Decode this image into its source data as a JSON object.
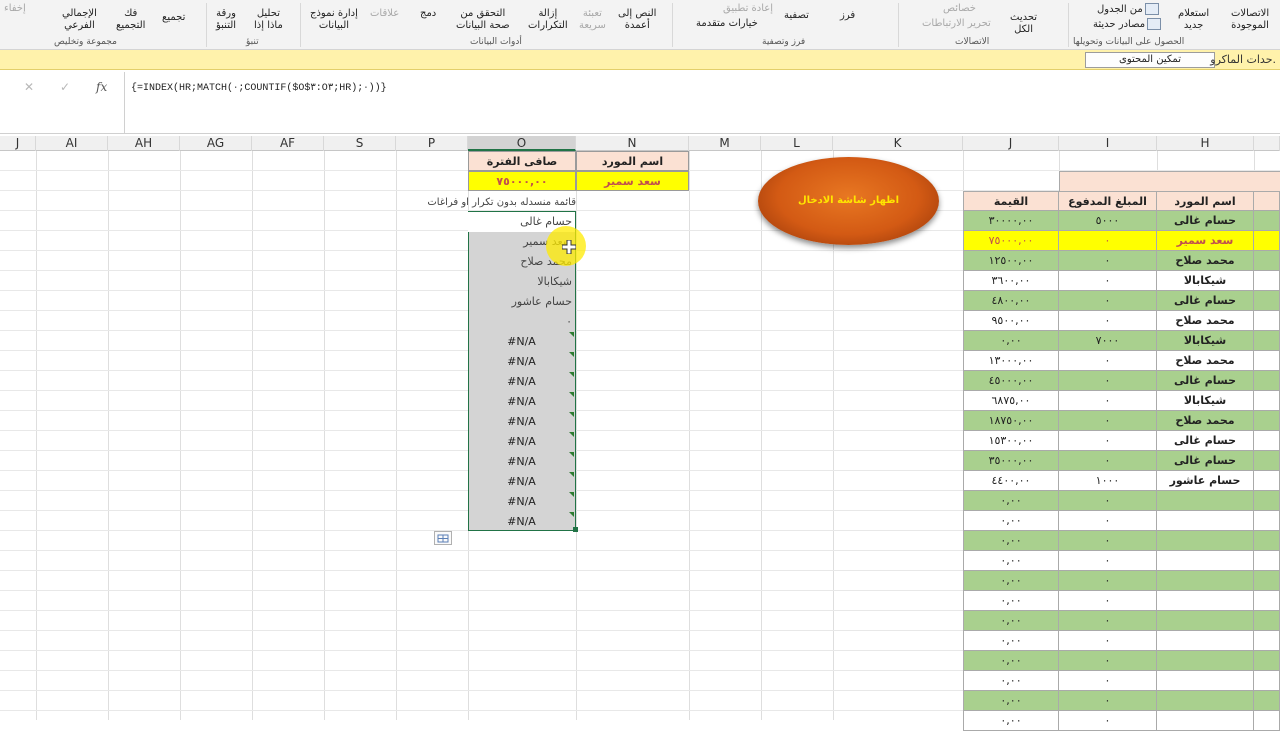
{
  "ribbon": {
    "buttons": {
      "existing_connections": "الاتصالات\nالموجودة",
      "new_query": "استعلام\nجديد",
      "from_table": "من الجدول",
      "recent_sources": "مصادر حديثة",
      "refresh_all": "تحديث\nالكل",
      "connections": "الاتصالات",
      "properties": "خصائص",
      "edit_links": "تحرير الارتباطات",
      "sort": "فرز",
      "filter": "تصفية",
      "clear": "مسح",
      "reapply": "إعادة تطبيق",
      "advanced": "خيارات متقدمة",
      "text_to_columns": "النص إلى\nأعمدة",
      "flash_fill": "تعبئة\nسريعة",
      "remove_duplicates": "إزالة\nالتكرارات",
      "data_validation": "التحقق من\nصحة البيانات",
      "consolidate": "دمج",
      "relationships": "علاقات",
      "manage_data_model": "إدارة نموذج\nالبيانات",
      "what_if": "تحليل\nماذا إذا",
      "forecast_sheet": "ورقة\nالتنبؤ",
      "group": "تجميع",
      "ungroup": "فك\nالتجميع",
      "subtotal": "الإجمالي\nالفرعي",
      "hide_detail": "إخفاء"
    },
    "groups": {
      "get_transform": "الحصول على البيانات وتحويلها",
      "connections": "الاتصالات",
      "sort_filter": "فرز وتصفية",
      "data_tools": "أدوات البيانات",
      "forecast": "تنبؤ",
      "outline": "مجموعة وتخليص"
    }
  },
  "message_bar": {
    "text": "حدات الماكرو.",
    "enable_button": "تمكين المحتوى"
  },
  "formula_bar": {
    "formula": "{=INDEX(HR;MATCH(٠;COUNTIF($O$٣:O٣;HR);٠))}",
    "icons": [
      "cancel-icon",
      "enter-icon",
      "fx-icon"
    ]
  },
  "columns": [
    "J",
    "AI",
    "AH",
    "AG",
    "AF",
    "S",
    "P",
    "O",
    "N",
    "M",
    "L",
    "K",
    "J",
    "I",
    "H"
  ],
  "summary": {
    "header_supplier": "اسم المورد",
    "header_net": "صافى الفترة",
    "supplier_value": "سعد سمير",
    "net_value": "٧٥٠٠٠,٠٠"
  },
  "list": {
    "title": "قائمة منسدله بدون تكرار او فراغات",
    "items": [
      "حسام غالى",
      "سعد سمير",
      "محمد صلاح",
      "شيكابالا",
      "حسام عاشور",
      "٠",
      "#N/A",
      "#N/A",
      "#N/A",
      "#N/A",
      "#N/A",
      "#N/A",
      "#N/A",
      "#N/A",
      "#N/A",
      "#N/A"
    ]
  },
  "button_oval": "اظهار شاشة الادخال",
  "table": {
    "headers": [
      "القيمة",
      "المبلغ المدفوع",
      "اسم المورد"
    ],
    "rows": [
      [
        "٣٠٠٠٠,٠٠",
        "٥٠٠٠",
        "حسام غالى"
      ],
      [
        "٧٥٠٠٠,٠٠",
        "٠",
        "سعد سمير"
      ],
      [
        "١٢٥٠٠,٠٠",
        "٠",
        "محمد صلاح"
      ],
      [
        "٣٦٠٠,٠٠",
        "٠",
        "شيكابالا"
      ],
      [
        "٤٨٠٠,٠٠",
        "٠",
        "حسام غالى"
      ],
      [
        "٩٥٠٠,٠٠",
        "٠",
        "محمد صلاح"
      ],
      [
        "٠,٠٠",
        "٧٠٠٠",
        "شيكابالا"
      ],
      [
        "١٣٠٠٠,٠٠",
        "٠",
        "محمد صلاح"
      ],
      [
        "٤٥٠٠٠,٠٠",
        "٠",
        "حسام غالى"
      ],
      [
        "٦٨٧٥,٠٠",
        "٠",
        "شيكابالا"
      ],
      [
        "١٨٧٥٠,٠٠",
        "٠",
        "محمد صلاح"
      ],
      [
        "١٥٣٠٠,٠٠",
        "٠",
        "حسام غالى"
      ],
      [
        "٣٥٠٠٠,٠٠",
        "٠",
        "حسام غالى"
      ],
      [
        "٤٤٠٠,٠٠",
        "١٠٠٠",
        "حسام عاشور"
      ],
      [
        "٠,٠٠",
        "٠",
        ""
      ],
      [
        "٠,٠٠",
        "٠",
        ""
      ],
      [
        "٠,٠٠",
        "٠",
        ""
      ],
      [
        "٠,٠٠",
        "٠",
        ""
      ],
      [
        "٠,٠٠",
        "٠",
        ""
      ],
      [
        "٠,٠٠",
        "٠",
        ""
      ],
      [
        "٠,٠٠",
        "٠",
        ""
      ],
      [
        "٠,٠٠",
        "٠",
        ""
      ],
      [
        "٠,٠٠",
        "٠",
        ""
      ],
      [
        "٠,٠٠",
        "٠",
        ""
      ],
      [
        "٠,٠٠",
        "٠",
        ""
      ],
      [
        "٠,٠٠",
        "٠",
        ""
      ]
    ]
  },
  "colors": {
    "green_row": "#a9d08e",
    "highlight_row": "#ffff00",
    "header_fill": "#fbe1d3",
    "accent": "#217346",
    "highlight_text": "#c0504d"
  }
}
